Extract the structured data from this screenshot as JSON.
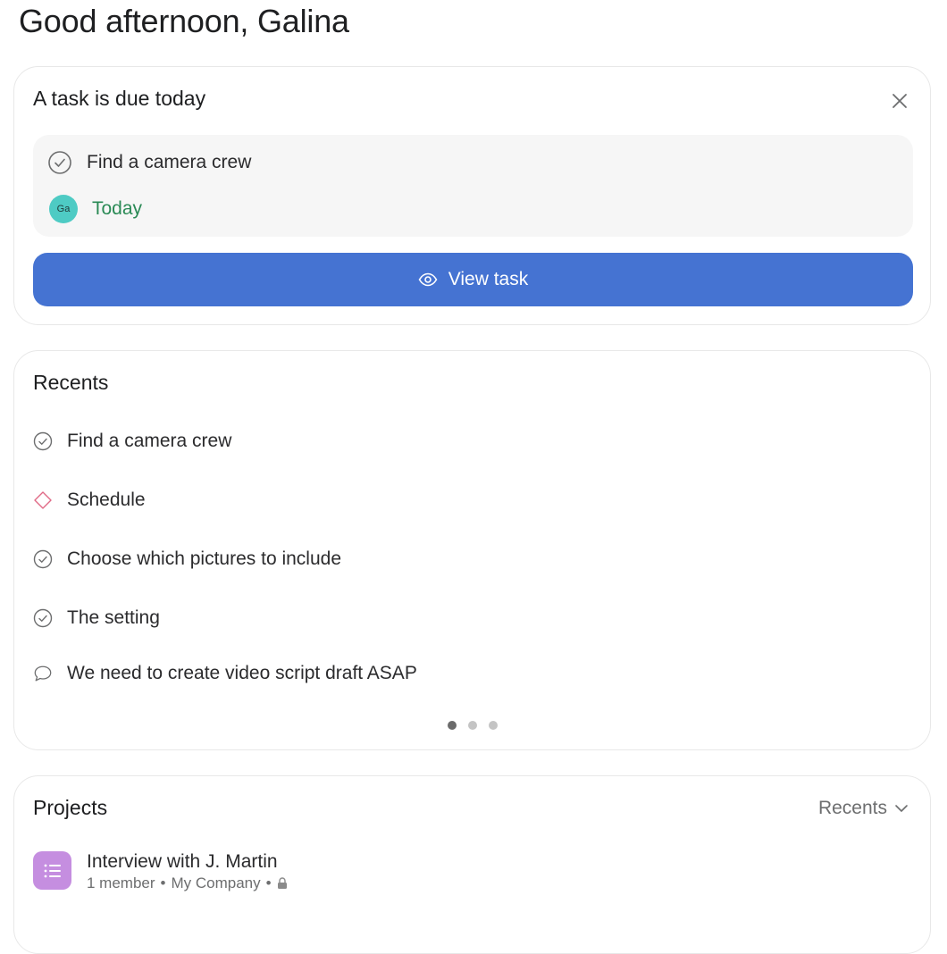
{
  "greeting": "Good afternoon, Galina",
  "due_card": {
    "title": "A task is due today",
    "task_name": "Find a camera crew",
    "assignee_initials": "Ga",
    "due_label": "Today",
    "button_label": "View task"
  },
  "recents": {
    "title": "Recents",
    "items": [
      {
        "label": "Find a camera crew",
        "icon": "check-circle-icon"
      },
      {
        "label": "Schedule",
        "icon": "milestone-diamond-icon"
      },
      {
        "label": "Choose which pictures to include",
        "icon": "check-circle-icon"
      },
      {
        "label": "The setting",
        "icon": "check-circle-icon"
      },
      {
        "label": "We need to create video script draft ASAP",
        "icon": "comment-bubble-icon"
      }
    ],
    "page_count": 3,
    "active_page": 1
  },
  "projects": {
    "title": "Projects",
    "sort_label": "Recents",
    "items": [
      {
        "name": "Interview with J. Martin",
        "members": "1 member",
        "team": "My Company",
        "icon": "list-icon"
      }
    ]
  },
  "colors": {
    "accent_button": "#4573d2",
    "due_today": "#2a8a55",
    "avatar": "#4ecbc4",
    "project_icon": "#c58ee0",
    "milestone": "#e06a87"
  }
}
